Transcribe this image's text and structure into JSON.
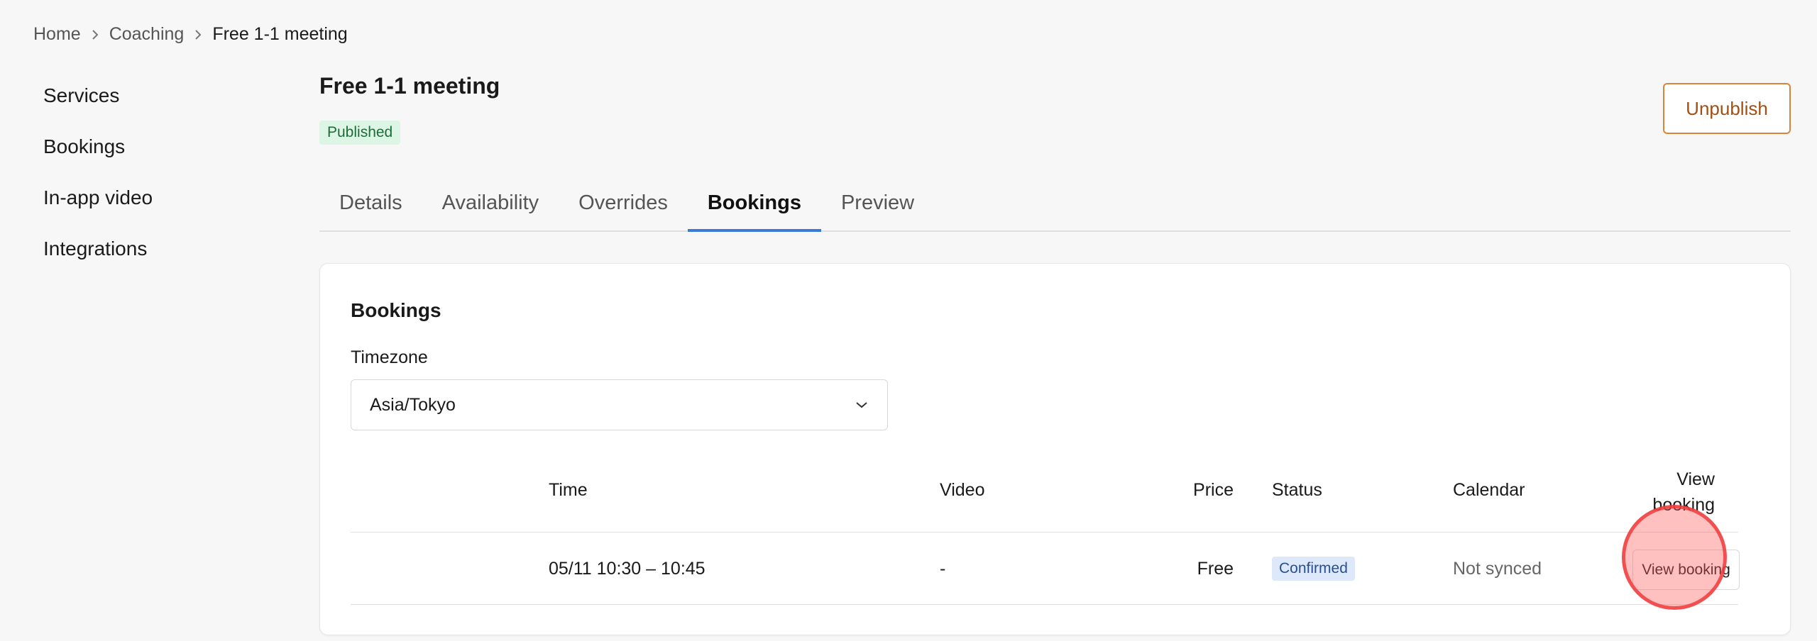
{
  "breadcrumb": {
    "items": [
      "Home",
      "Coaching"
    ],
    "current": "Free 1-1 meeting"
  },
  "sidebar": {
    "items": [
      {
        "label": "Services"
      },
      {
        "label": "Bookings"
      },
      {
        "label": "In-app video"
      },
      {
        "label": "Integrations"
      }
    ]
  },
  "header": {
    "title": "Free 1-1 meeting",
    "status": "Published",
    "unpublish_label": "Unpublish"
  },
  "tabs": [
    {
      "label": "Details"
    },
    {
      "label": "Availability"
    },
    {
      "label": "Overrides"
    },
    {
      "label": "Bookings",
      "active": true
    },
    {
      "label": "Preview"
    }
  ],
  "bookings": {
    "title": "Bookings",
    "timezone_label": "Timezone",
    "timezone_value": "Asia/Tokyo",
    "columns": {
      "time": "Time",
      "video": "Video",
      "price": "Price",
      "status": "Status",
      "calendar": "Calendar",
      "view": "View booking"
    },
    "rows": [
      {
        "time": "05/11 10:30 – 10:45",
        "video": "-",
        "price": "Free",
        "status": "Confirmed",
        "calendar": "Not synced",
        "action": "View booking"
      }
    ]
  },
  "colors": {
    "accent": "#3a7bd5",
    "unpublish": "#a34e12",
    "published_bg": "#dcf5e4",
    "confirmed_bg": "#dde8fa",
    "click_marker": "#f03c3c"
  }
}
